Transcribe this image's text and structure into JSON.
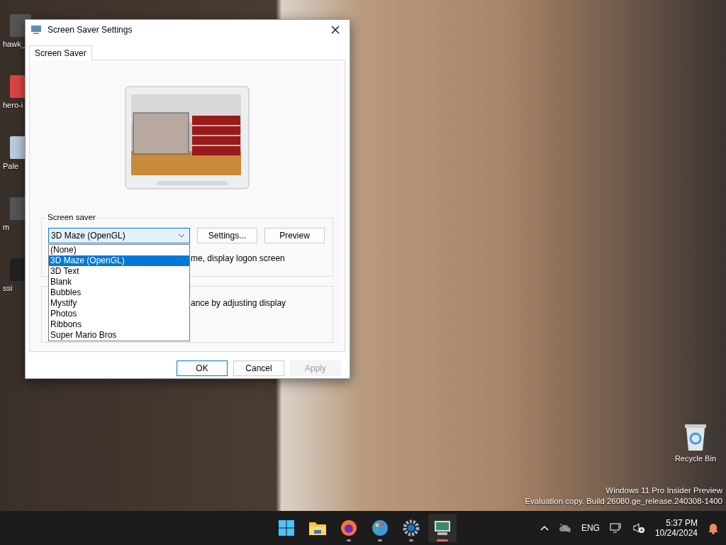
{
  "desktop": {
    "icons": [
      {
        "label": "hawk_",
        "kind": "photo"
      },
      {
        "label": "hero-i",
        "kind": "picture"
      },
      {
        "label": "Pale",
        "kind": "shortcut"
      },
      {
        "label": "m",
        "kind": "photo"
      },
      {
        "label": "ssi",
        "kind": "program"
      }
    ],
    "recycle_bin": {
      "label": "Recycle Bin"
    },
    "os_notice": [
      "Windows 11 Pro Insider Preview",
      "Evaluation copy. Build 26080.ge_release.240308-1400"
    ]
  },
  "dialog": {
    "title": "Screen Saver Settings",
    "tabs": [
      {
        "label": "Screen Saver",
        "selected": true
      }
    ],
    "screen_saver_group": {
      "label": "Screen saver",
      "combo_value": "3D Maze (OpenGL)",
      "settings_button": "Settings...",
      "preview_button": "Preview",
      "resume_text": "me, display logon screen"
    },
    "power_text": "ance by adjusting display",
    "dropdown_options": [
      {
        "label": "(None)",
        "selected": false
      },
      {
        "label": "3D Maze (OpenGL)",
        "selected": true
      },
      {
        "label": "3D Text",
        "selected": false
      },
      {
        "label": "Blank",
        "selected": false
      },
      {
        "label": "Bubbles",
        "selected": false
      },
      {
        "label": "Mystify",
        "selected": false
      },
      {
        "label": "Photos",
        "selected": false
      },
      {
        "label": "Ribbons",
        "selected": false
      },
      {
        "label": "Super Mario Bros",
        "selected": false
      }
    ],
    "buttons": [
      {
        "label": "OK",
        "default": true,
        "disabled": false
      },
      {
        "label": "Cancel",
        "default": false,
        "disabled": false
      },
      {
        "label": "Apply",
        "default": false,
        "disabled": true
      }
    ]
  },
  "taskbar": {
    "apps": [
      {
        "kind": "start",
        "running": false,
        "active": false
      },
      {
        "kind": "folder",
        "running": false,
        "active": false
      },
      {
        "kind": "browser",
        "running": true,
        "active": false
      },
      {
        "kind": "paint",
        "running": true,
        "active": false
      },
      {
        "kind": "settings",
        "running": true,
        "active": false
      },
      {
        "kind": "monitor",
        "running": true,
        "active": true
      }
    ],
    "language": "ENG",
    "time": "5:37 PM",
    "date": "10/24/2024"
  }
}
